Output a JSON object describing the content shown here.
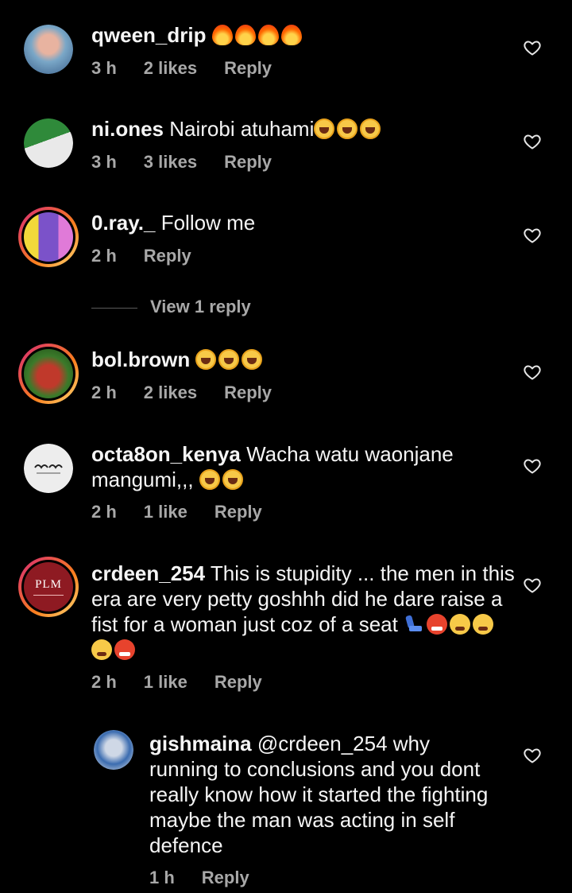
{
  "comments": [
    {
      "username": "qween_drip",
      "text": "",
      "emojis": [
        "fire",
        "fire",
        "fire",
        "fire"
      ],
      "time": "3 h",
      "likes": "2 likes",
      "reply_label": "Reply"
    },
    {
      "username": "ni.ones",
      "text": "Nairobi atuhami",
      "emojis": [
        "laugh",
        "laugh",
        "laugh"
      ],
      "time": "3 h",
      "likes": "3 likes",
      "reply_label": "Reply"
    },
    {
      "username": "0.ray._",
      "text": "Follow me",
      "emojis": [],
      "time": "2 h",
      "likes": "",
      "reply_label": "Reply",
      "view_replies": "View 1 reply"
    },
    {
      "username": "bol.brown",
      "text": "",
      "emojis": [
        "laugh",
        "laugh",
        "laugh"
      ],
      "time": "2 h",
      "likes": "2 likes",
      "reply_label": "Reply"
    },
    {
      "username": "octa8on_kenya",
      "text": "Wacha watu waonjane mangumi,,,",
      "emojis": [
        "laugh",
        "laugh"
      ],
      "time": "2 h",
      "likes": "1 like",
      "reply_label": "Reply"
    },
    {
      "username": "crdeen_254",
      "text": "This is stupidity ... the men in this era are very petty goshhh did he dare raise a fist for a woman just coz of a seat",
      "emojis": [
        "seat",
        "angry",
        "steam",
        "steam",
        "steam",
        "angry"
      ],
      "time": "2 h",
      "likes": "1 like",
      "reply_label": "Reply",
      "avatar_text": "PLM"
    },
    {
      "username": "gishmaina",
      "text": "@crdeen_254 why running to conclusions and you dont really know how it started the fighting maybe the man was acting in self defence",
      "emojis": [],
      "time": "1 h",
      "likes": "",
      "reply_label": "Reply"
    }
  ],
  "colors": {
    "background": "#000000",
    "text": "#f5f5f5",
    "muted": "#a8a8a8",
    "story_ring_start": "#d62976",
    "story_ring_end": "#feda75"
  },
  "icons": {
    "like": "heart-outline-icon"
  }
}
